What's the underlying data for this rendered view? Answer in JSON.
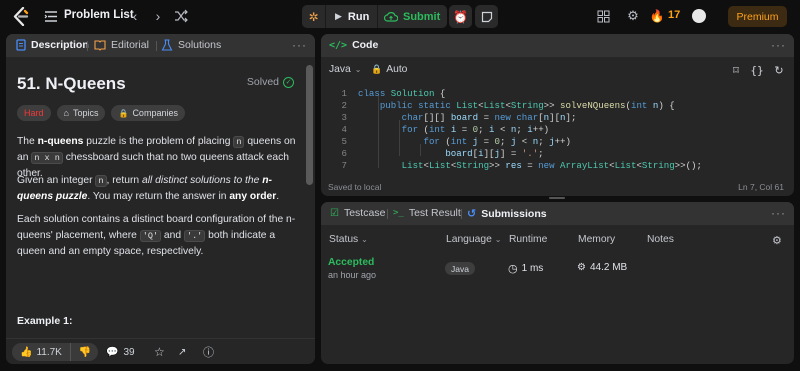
{
  "topbar": {
    "title": "Problem List",
    "run_label": "Run",
    "submit_label": "Submit",
    "streak_count": "17",
    "premium_label": "Premium"
  },
  "left": {
    "tabs": [
      "Description",
      "Editorial",
      "Solutions"
    ],
    "title": "51. N-Queens",
    "solved_label": "Solved",
    "chips": {
      "difficulty": "Hard",
      "topics": "Topics",
      "companies": "Companies"
    },
    "p1": {
      "a": "The ",
      "b": "n-queens",
      "c": " puzzle is the problem of placing ",
      "n1": "n",
      "d": " queens on an ",
      "nxn": "n x n",
      "e": " chessboard such that no two queens attack each other."
    },
    "p2": {
      "a": "Given an integer ",
      "n": "n",
      "b": ", return ",
      "c": "all distinct solutions to the ",
      "d": "n-queens puzzle",
      "e": ". You may return the answer in ",
      "f": "any order",
      "g": "."
    },
    "p3": {
      "a": "Each solution contains a distinct board configuration of the n-queens' placement, where ",
      "q": "'Q'",
      "b": " and ",
      "dot": "'.'",
      "c": " both indicate a queen and an empty space, respectively."
    },
    "example_label": "Example 1:",
    "board_colors": {
      "orange": "#f5a623",
      "light": "#dbe4f3",
      "white": "#ffffff"
    },
    "footer": {
      "likes": "11.7K",
      "comments": "39"
    }
  },
  "code": {
    "header": "Code",
    "language": "Java",
    "mode": "Auto",
    "lines": [
      {
        "n": "1"
      },
      {
        "n": "2"
      },
      {
        "n": "3"
      },
      {
        "n": "4"
      },
      {
        "n": "5"
      },
      {
        "n": "6"
      },
      {
        "n": "7"
      }
    ],
    "saved": "Saved to local",
    "cursor": "Ln 7, Col 61"
  },
  "results": {
    "tabs": [
      "Testcase",
      "Test Result",
      "Submissions"
    ],
    "columns": [
      "Status",
      "Language",
      "Runtime",
      "Memory",
      "Notes"
    ],
    "row": {
      "status": "Accepted",
      "time": "an hour ago",
      "language": "Java",
      "runtime": "1 ms",
      "memory": "44.2 MB"
    }
  },
  "colors": {
    "accent": "#ffa116",
    "success": "#2cbb5d",
    "hard": "#f63737"
  }
}
